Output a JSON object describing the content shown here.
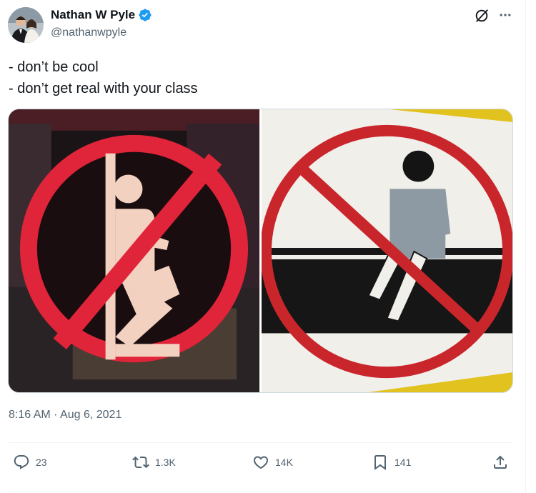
{
  "author": {
    "display_name": "Nathan W Pyle",
    "handle": "@nathanwpyle",
    "verified": true,
    "verified_color": "#1d9bf0"
  },
  "tweet": {
    "lines": [
      "- don’t be cool",
      "- don’t get real with your class"
    ]
  },
  "media": {
    "left_icon": "no-leaning-sign-icon",
    "right_icon": "no-sitting-sign-icon",
    "prohibition_color": "#d7263d"
  },
  "meta": {
    "time": "8:16 AM",
    "separator": " · ",
    "date": "Aug 6, 2021"
  },
  "actions": {
    "reply_count": "23",
    "retweet_count": "1.3K",
    "like_count": "14K",
    "bookmark_count": "141"
  },
  "colors": {
    "text_primary": "#0f1419",
    "text_secondary": "#536471",
    "border": "#eff3f4"
  }
}
